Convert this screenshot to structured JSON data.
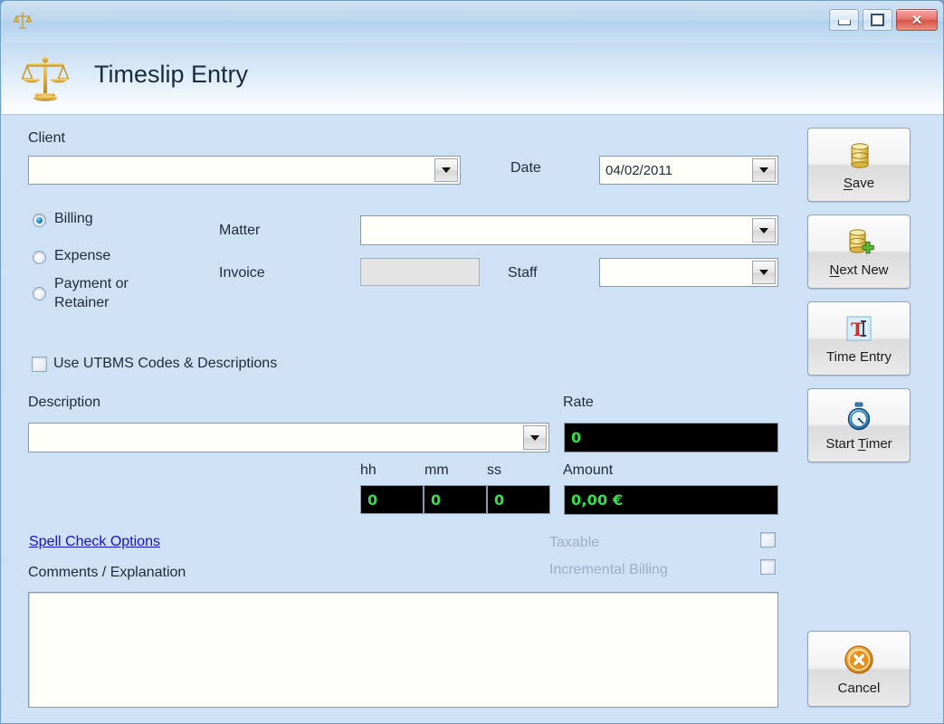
{
  "window": {
    "title_icon": "scales-of-justice-icon",
    "controls": {
      "minimize_label": "–",
      "restore_label": "□",
      "close_label": "✕"
    }
  },
  "header": {
    "title": "Timeslip Entry",
    "icon": "scales-of-justice-icon"
  },
  "form": {
    "client": {
      "label": "Client",
      "value": "",
      "icon": "chevron-down-icon"
    },
    "date": {
      "label": "Date",
      "value": "04/02/2011",
      "icon": "chevron-down-icon"
    },
    "entry_type": {
      "options": [
        {
          "label": "Billing",
          "selected": true
        },
        {
          "label": "Expense",
          "selected": false
        },
        {
          "label": "Payment or Retainer",
          "selected": false
        }
      ]
    },
    "matter": {
      "label": "Matter",
      "value": "",
      "icon": "chevron-down-icon"
    },
    "invoice": {
      "label": "Invoice",
      "value": "",
      "disabled": true
    },
    "staff": {
      "label": "Staff",
      "value": "",
      "icon": "chevron-down-icon"
    },
    "utbms": {
      "label": "Use UTBMS Codes & Descriptions",
      "checked": false
    },
    "description": {
      "label": "Description",
      "value": "",
      "icon": "chevron-down-icon"
    },
    "rate": {
      "label": "Rate",
      "value": "0"
    },
    "time": {
      "hh_label": "hh",
      "mm_label": "mm",
      "ss_label": "ss",
      "hh": "0",
      "mm": "0",
      "ss": "0"
    },
    "amount": {
      "label": "Amount",
      "value": "0,00 €"
    },
    "spell_check_link": "Spell Check Options",
    "taxable": {
      "label": "Taxable",
      "checked": false,
      "disabled": true
    },
    "incremental_billing": {
      "label": "Incremental Billing",
      "checked": false,
      "disabled": true
    },
    "comments": {
      "label": "Comments / Explanation",
      "value": ""
    }
  },
  "buttons": {
    "save": {
      "label_pre": "",
      "label_key": "S",
      "label_post": "ave",
      "icon": "database-barrel-icon"
    },
    "next_new": {
      "label_pre": "",
      "label_key": "N",
      "label_post": "ext New",
      "icon": "database-barrel-plus-icon"
    },
    "time_entry": {
      "label_pre": "Time Entry",
      "label_key": "",
      "label_post": "",
      "icon": "text-cursor-icon"
    },
    "start_timer": {
      "label_pre": "Start ",
      "label_key": "T",
      "label_post": "imer",
      "icon": "stopwatch-icon"
    },
    "cancel": {
      "label_pre": "Cancel",
      "label_key": "",
      "label_post": "",
      "icon": "cancel-circle-icon"
    }
  },
  "colors": {
    "background": "#cfe1f5",
    "lcd_text": "#33e04a",
    "lcd_bg": "#000000",
    "link": "#1414cf",
    "accent_orange": "#e8941f",
    "close_red": "#d65448"
  }
}
